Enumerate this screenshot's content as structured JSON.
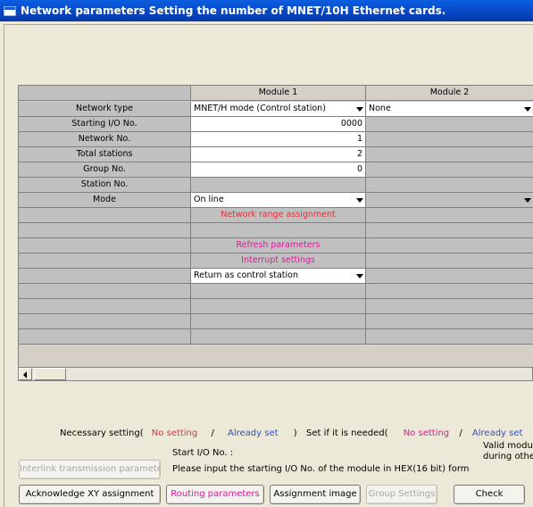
{
  "window": {
    "title": "Network parameters  Setting the number of MNET/10H Ethernet cards."
  },
  "grid": {
    "headers": [
      "",
      "Module 1",
      "Module 2"
    ],
    "rows": [
      {
        "label": "Network type",
        "m1": "MNET/H mode (Control station)",
        "m1_dropdown": true,
        "m2": "None",
        "m2_dropdown": true
      },
      {
        "label": "Starting I/O No.",
        "m1": "0000"
      },
      {
        "label": "Network No.",
        "m1": "1"
      },
      {
        "label": "Total stations",
        "m1": "2"
      },
      {
        "label": "Group No.",
        "m1": "0"
      },
      {
        "label": "Station No.",
        "m1": ""
      },
      {
        "label": "Mode",
        "m1": "On line",
        "m1_dropdown": true,
        "m2": "",
        "m2_dropdown": true
      },
      {
        "label": "",
        "m1": "Network range assignment"
      },
      {
        "label": "",
        "m1": ""
      },
      {
        "label": "",
        "m1": "Refresh parameters"
      },
      {
        "label": "",
        "m1": "Interrupt settings"
      },
      {
        "label": "",
        "m1": "Return as control station",
        "m1_dropdown": true
      },
      {
        "label": "",
        "m1": ""
      },
      {
        "label": "",
        "m1": ""
      },
      {
        "label": "",
        "m1": ""
      },
      {
        "label": "",
        "m1": ""
      }
    ]
  },
  "legend": {
    "necessary_label": "Necessary setting(",
    "no_setting": "No setting",
    "slash": "/",
    "already_set": "Already set",
    "close": ")",
    "if_needed_label": "Set if it is needed(",
    "no_setting_2": "No setting",
    "already_set_2": "Already set",
    "close_2": ")"
  },
  "info": {
    "start_io_label": "Start I/O No. :",
    "valid_module_line1": "Valid modul",
    "valid_module_line2": "during othe",
    "hint": "Please input the starting I/O No. of the module in HEX(16 bit) form"
  },
  "buttons": {
    "interlink": "Interlink transmission parameters",
    "acknowledge_xy": "Acknowledge XY assignment",
    "routing": "Routing parameters",
    "assignment_image": "Assignment image",
    "group_settings": "Group Settings",
    "check": "Check"
  },
  "colors": {
    "required_red": "#e0303a",
    "optional_pink": "#e0189a",
    "already_set_blue": "#3050c8",
    "title_blue": "#0847c4"
  }
}
